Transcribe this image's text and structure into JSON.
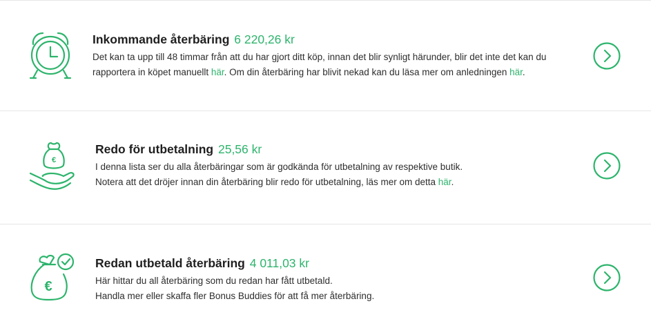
{
  "colors": {
    "accent": "#2db46c",
    "text": "#1f1f1f",
    "divider": "#e6e6e6"
  },
  "cards": [
    {
      "icon": "alarm-clock-icon",
      "title": "Inkommande återbäring",
      "amount": "6 220,26 kr",
      "line1": "Det kan ta upp till 48 timmar från att du har gjort ditt köp, innan det blir synligt härunder, blir det inte det kan du",
      "line2_a": "rapportera in köpet manuellt ",
      "line2_link": "här",
      "line2_b": ". Om din återbäring har blivit nekad kan du läsa mer om anledningen ",
      "line2_link2": "här",
      "line2_c": "."
    },
    {
      "icon": "money-bag-hand-icon",
      "title": "Redo för utbetalning",
      "amount": "25,56 kr",
      "line1": "I denna lista ser du alla återbäringar som är godkända för utbetalning av respektive butik.",
      "line2_a": "Notera att det dröjer innan din återbäring blir redo för utbetalning, läs mer om detta ",
      "line2_link": "här",
      "line2_b": "."
    },
    {
      "icon": "money-bag-check-icon",
      "title": "Redan utbetald återbäring",
      "amount": "4 011,03 kr",
      "line1": "Här hittar du all återbäring som du redan har fått utbetald.",
      "line2_a": "Handla mer eller skaffa fler Bonus Buddies för att få mer återbäring."
    }
  ]
}
